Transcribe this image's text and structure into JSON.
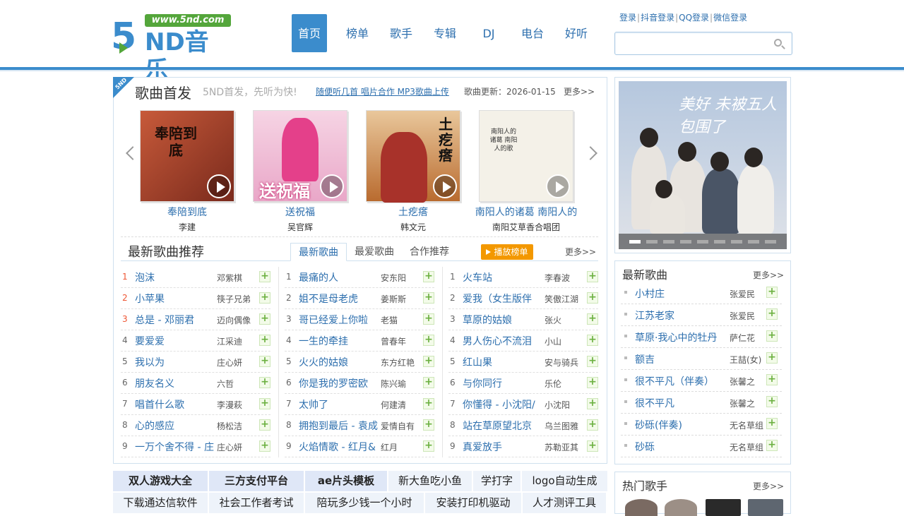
{
  "site": {
    "logo_url": "www.5nd.com",
    "logo_five": "5",
    "logo_text": "ND音乐"
  },
  "nav": [
    {
      "label": "首页",
      "active": true
    },
    {
      "label": "榜单"
    },
    {
      "label": "歌手"
    },
    {
      "label": "专辑"
    },
    {
      "label": "DJ"
    },
    {
      "label": "电台"
    },
    {
      "label": "好听"
    }
  ],
  "login": {
    "login": "登录",
    "douyin": "抖音登录",
    "qq": "QQ登录",
    "wechat": "微信登录"
  },
  "search": {
    "placeholder": ""
  },
  "first_release": {
    "corner": "5ND",
    "title": "歌曲首发",
    "slogan": "5ND首发，先听为快!",
    "links": "随便听几首 唱片合作 MP3歌曲上传",
    "update": "歌曲更新：2026-01-15",
    "more": "更多>>",
    "albums": [
      {
        "name": "奉陪到底",
        "artist": "李建",
        "cover_text": "奉陪到底"
      },
      {
        "name": "送祝福",
        "artist": "吴官辉",
        "cover_text": "送祝福"
      },
      {
        "name": "土疙瘩",
        "artist": "韩文元",
        "cover_text": "土疙瘩"
      },
      {
        "name": "南阳人的诸葛 南阳人的",
        "artist": "南阳艾草香合唱团",
        "cover_text": "南阳人的诸葛 南阳人的歌"
      }
    ]
  },
  "recommend": {
    "title": "最新歌曲推荐",
    "tabs": [
      "最新歌曲",
      "最爱歌曲",
      "合作推荐"
    ],
    "playlist_button": "播放榜单",
    "more": "更多>>",
    "columns": [
      [
        {
          "n": "1",
          "song": "泡沫",
          "singer": "邓紫棋"
        },
        {
          "n": "2",
          "song": "小苹果",
          "singer": "筷子兄弟"
        },
        {
          "n": "3",
          "song": "总是 - 邓丽君",
          "singer": "迈向偶像"
        },
        {
          "n": "4",
          "song": "要爱爱",
          "singer": "江采迪"
        },
        {
          "n": "5",
          "song": "我以为",
          "singer": "庄心妍"
        },
        {
          "n": "6",
          "song": "朋友名义",
          "singer": "六哲"
        },
        {
          "n": "7",
          "song": "唱首什么歌",
          "singer": "李漫萩"
        },
        {
          "n": "8",
          "song": "心的感应",
          "singer": "杨松洁"
        },
        {
          "n": "9",
          "song": "一万个舍不得 - 庄",
          "singer": "庄心妍"
        }
      ],
      [
        {
          "n": "1",
          "song": "最痛的人",
          "singer": "安东阳"
        },
        {
          "n": "2",
          "song": "姐不是母老虎",
          "singer": "姜斯斯"
        },
        {
          "n": "3",
          "song": "哥已经爱上你啦",
          "singer": "老猫"
        },
        {
          "n": "4",
          "song": "一生的牵挂",
          "singer": "曾春年"
        },
        {
          "n": "5",
          "song": "火火的姑娘",
          "singer": "东方红艳"
        },
        {
          "n": "6",
          "song": "你是我的罗密欧",
          "singer": "陈兴瑜"
        },
        {
          "n": "7",
          "song": "太帅了",
          "singer": "何建清"
        },
        {
          "n": "8",
          "song": "拥抱到最后 - 袁成",
          "singer": "爱情自有"
        },
        {
          "n": "9",
          "song": "火焰情歌 - 红月&",
          "singer": "红月"
        }
      ],
      [
        {
          "n": "1",
          "song": "火车站",
          "singer": "李春波"
        },
        {
          "n": "2",
          "song": "爱我（女生版伴",
          "singer": "笑傲江湖"
        },
        {
          "n": "3",
          "song": "草原的姑娘",
          "singer": "张火"
        },
        {
          "n": "4",
          "song": "男人伤心不流泪",
          "singer": "小山"
        },
        {
          "n": "5",
          "song": "红山果",
          "singer": "安与骑兵"
        },
        {
          "n": "6",
          "song": "与你同行",
          "singer": "乐伦"
        },
        {
          "n": "7",
          "song": "你懂得 - 小沈阳/",
          "singer": "小沈阳"
        },
        {
          "n": "8",
          "song": "站在草原望北京",
          "singer": "乌兰图雅"
        },
        {
          "n": "9",
          "song": "真爱放手",
          "singer": "苏勒亚其"
        }
      ]
    ]
  },
  "banner": {
    "caption": "美好 未被五人包围了",
    "dots": 9,
    "active_dot": 1
  },
  "latest": {
    "title": "最新歌曲",
    "more": "更多>>",
    "items": [
      {
        "song": "小村庄",
        "singer": "张爱民"
      },
      {
        "song": "江苏老家",
        "singer": "张爱民"
      },
      {
        "song": "草原·我心中的牡丹",
        "singer": "萨仁花"
      },
      {
        "song": "额吉",
        "singer": "王喆(女)"
      },
      {
        "song": "很不平凡（伴奏）",
        "singer": "张馨之"
      },
      {
        "song": "很不平凡",
        "singer": "张馨之"
      },
      {
        "song": "砂砾(伴奏)",
        "singer": "无名草组"
      },
      {
        "song": "砂砾",
        "singer": "无名草组"
      }
    ]
  },
  "hot_singers": {
    "title": "热门歌手",
    "more": "更多>>"
  },
  "ad_links": [
    [
      {
        "label": "双人游戏大全",
        "bold": true
      },
      {
        "label": "三方支付平台",
        "bold": true
      },
      {
        "label": "ae片头模板",
        "bold": true
      },
      {
        "label": "新大鱼吃小鱼"
      },
      {
        "label": "学打字"
      },
      {
        "label": "logo自动生成"
      }
    ],
    [
      {
        "label": "下载通达信软件"
      },
      {
        "label": "社会工作者考试"
      },
      {
        "label": "陪玩多少钱一个小时"
      },
      {
        "label": "安装打印机驱动"
      },
      {
        "label": "人才测评工具"
      }
    ]
  ],
  "colors": {
    "brand_blue": "#3b8ccc",
    "brand_green": "#54a63b",
    "link": "#2d6fae",
    "orange": "#f39800",
    "hot_number": "#e53"
  }
}
